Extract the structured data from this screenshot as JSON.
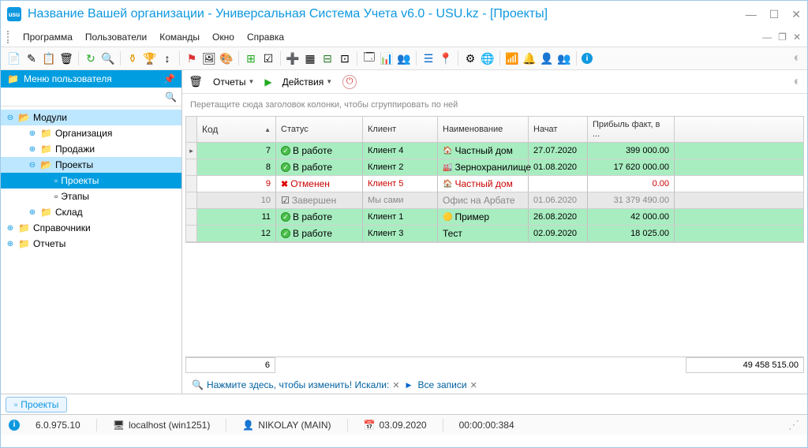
{
  "window": {
    "title": "Название Вашей организации - Универсальная Система Учета v6.0 - USU.kz - [Проекты]"
  },
  "menubar": {
    "items": [
      "Программа",
      "Пользователи",
      "Команды",
      "Окно",
      "Справка"
    ]
  },
  "sidebar": {
    "header": "Меню пользователя",
    "tree": {
      "modules": "Модули",
      "org": "Организация",
      "sales": "Продажи",
      "projects": "Проекты",
      "projects_sub": "Проекты",
      "stages": "Этапы",
      "warehouse": "Склад",
      "directories": "Справочники",
      "reports": "Отчеты"
    }
  },
  "content_toolbar": {
    "reports": "Отчеты",
    "actions": "Действия"
  },
  "grid": {
    "group_hint": "Перетащите сюда заголовок колонки, чтобы сгруппировать по ней",
    "headers": {
      "code": "Код",
      "status": "Статус",
      "client": "Клиент",
      "name": "Наименование",
      "started": "Начат",
      "profit": "Прибыль факт, в ..."
    },
    "rows": [
      {
        "code": "7",
        "status": "В работе",
        "status_type": "work",
        "client": "Клиент 4",
        "name": "Частный дом",
        "date": "27.07.2020",
        "profit": "399 000.00",
        "row_style": "green",
        "name_icon": "🏠"
      },
      {
        "code": "8",
        "status": "В работе",
        "status_type": "work",
        "client": "Клиент 2",
        "name": "Зернохранилище",
        "date": "01.08.2020",
        "profit": "17 620 000.00",
        "row_style": "green",
        "name_icon": "🏭"
      },
      {
        "code": "9",
        "status": "Отменен",
        "status_type": "cancel",
        "client": "Клиент 5",
        "name": "Частный дом",
        "date": "",
        "profit": "0.00",
        "row_style": "white",
        "name_icon": "🏠"
      },
      {
        "code": "10",
        "status": "Завершен",
        "status_type": "done",
        "client": "Мы сами",
        "name": "Офис на Арбате",
        "date": "01.06.2020",
        "profit": "31 379 490.00",
        "row_style": "gray",
        "name_icon": ""
      },
      {
        "code": "11",
        "status": "В работе",
        "status_type": "work",
        "client": "Клиент 1",
        "name": "Пример",
        "date": "26.08.2020",
        "profit": "42 000.00",
        "row_style": "green",
        "name_icon": "🟡"
      },
      {
        "code": "12",
        "status": "В работе",
        "status_type": "work",
        "client": "Клиент 3",
        "name": "Тест",
        "date": "02.09.2020",
        "profit": "18 025.00",
        "row_style": "green",
        "name_icon": ""
      }
    ],
    "footer": {
      "count": "6",
      "total": "49 458 515.00"
    }
  },
  "filter": {
    "edit_hint": "Нажмите здесь, чтобы изменить! Искали:",
    "all_records": "Все записи"
  },
  "tab": {
    "projects": "Проекты"
  },
  "statusbar": {
    "version": "6.0.975.10",
    "host": "localhost (win1251)",
    "user": "NIKOLAY (MAIN)",
    "date": "03.09.2020",
    "time": "00:00:00:384"
  }
}
